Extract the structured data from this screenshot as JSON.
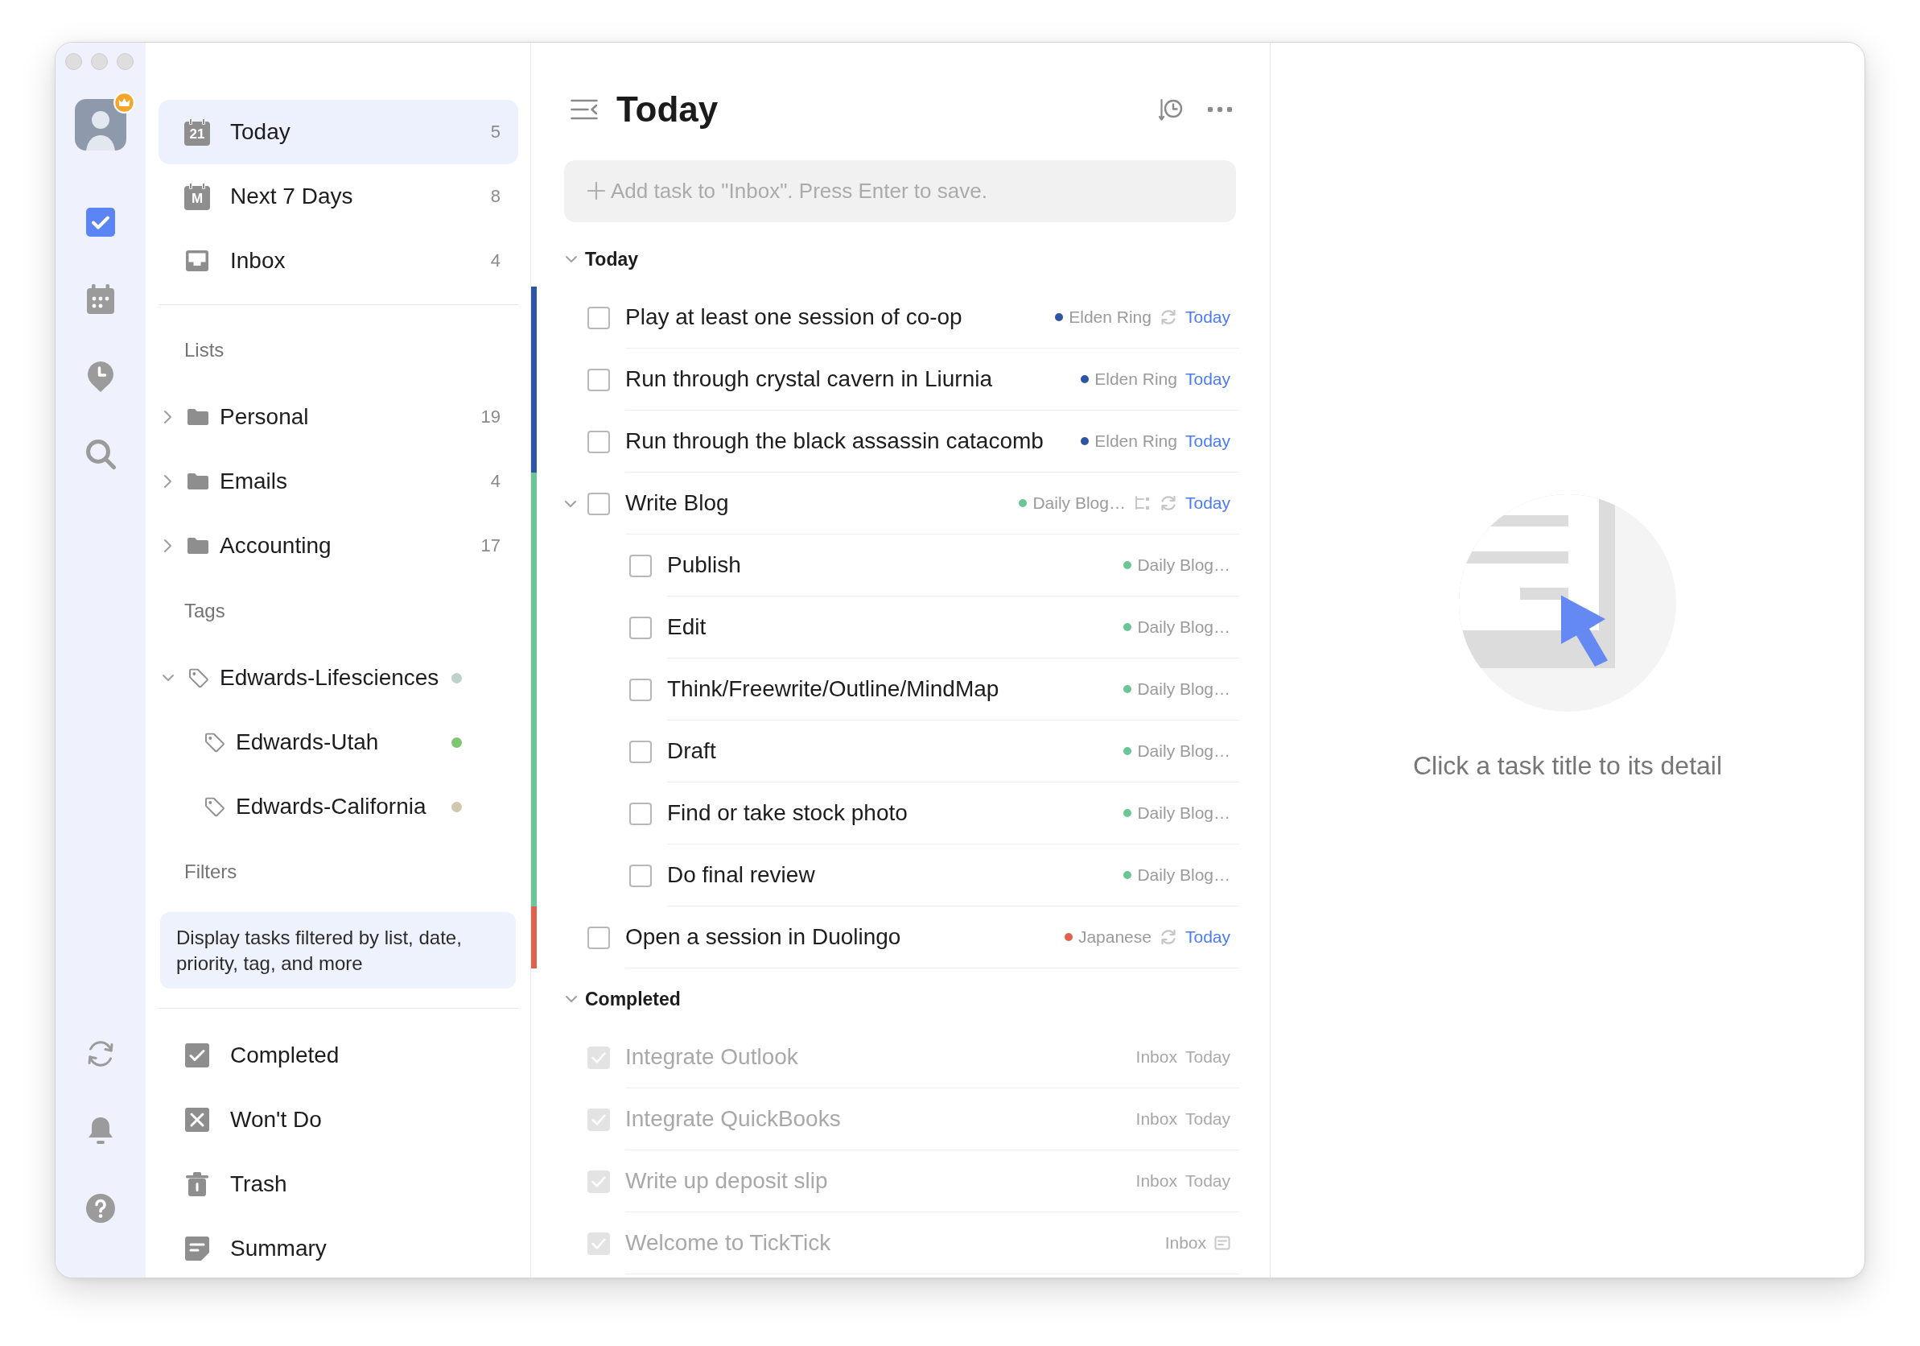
{
  "rail": {
    "avatar": {
      "premium": true
    },
    "top_items": [
      {
        "kind": "tasks",
        "selected": true
      },
      {
        "kind": "calendar",
        "selected": false
      },
      {
        "kind": "focus",
        "selected": false
      },
      {
        "kind": "search",
        "selected": false
      }
    ],
    "bottom_items": [
      {
        "kind": "sync"
      },
      {
        "kind": "notifications"
      },
      {
        "kind": "help"
      }
    ]
  },
  "sidebar": {
    "smart_lists": [
      {
        "kind": "today",
        "label": "Today",
        "icon_label": "21",
        "count": "5",
        "selected": true
      },
      {
        "kind": "week",
        "label": "Next 7 Days",
        "icon_label": "M",
        "count": "8",
        "selected": false
      },
      {
        "kind": "inbox",
        "label": "Inbox",
        "count": "4",
        "selected": false
      }
    ],
    "lists_title": "Lists",
    "lists": [
      {
        "label": "Personal",
        "count": "19",
        "expanded": false,
        "selected": false
      },
      {
        "label": "Emails",
        "count": "4",
        "expanded": false,
        "selected": false
      },
      {
        "label": "Accounting",
        "count": "17",
        "expanded": false,
        "selected": false
      }
    ],
    "tags_title": "Tags",
    "tags": [
      {
        "label": "Edwards-Lifesciences",
        "color": "#bed1cb",
        "expanded": true,
        "selected": false,
        "children": [
          {
            "label": "Edwards-Utah",
            "color": "#7dc76f",
            "selected": false
          },
          {
            "label": "Edwards-California",
            "color": "#cfc8ae",
            "selected": false
          }
        ]
      }
    ],
    "filters_title": "Filters",
    "filters_hint": "Display tasks filtered by list, date, priority, tag, and more",
    "system_lists": [
      {
        "kind": "completed",
        "label": "Completed",
        "selected": false
      },
      {
        "kind": "wont_do",
        "label": "Won't Do",
        "selected": false
      },
      {
        "kind": "trash",
        "label": "Trash",
        "selected": false
      },
      {
        "kind": "summary",
        "label": "Summary",
        "selected": false
      }
    ]
  },
  "main": {
    "title": "Today",
    "add_task": {
      "placeholder": "Add task to \"Inbox\". Press Enter to save."
    },
    "sections": [
      {
        "title": "Today",
        "expanded": true,
        "tasks": [
          {
            "title": "Play at least one session of co-op",
            "checked": false,
            "list": "Elden Ring",
            "color": "#2d55a6",
            "repeat": true,
            "due": "Today"
          },
          {
            "title": "Run through crystal cavern in Liurnia",
            "checked": false,
            "list": "Elden Ring",
            "color": "#2d55a6",
            "repeat": false,
            "due": "Today"
          },
          {
            "title": "Run through the black assassin catacomb",
            "checked": false,
            "list": "Elden Ring",
            "color": "#2d55a6",
            "repeat": false,
            "due": "Today"
          },
          {
            "title": "Write Blog",
            "checked": false,
            "list": "Daily Blog…",
            "color": "#6cc595",
            "repeat": true,
            "due": "Today",
            "expanded": true,
            "children": [
              {
                "title": "Publish",
                "checked": false,
                "list": "Daily Blog…",
                "color": "#6cc595"
              },
              {
                "title": "Edit",
                "checked": false,
                "list": "Daily Blog…",
                "color": "#6cc595"
              },
              {
                "title": "Think/Freewrite/Outline/MindMap",
                "checked": false,
                "list": "Daily Blog…",
                "color": "#6cc595"
              },
              {
                "title": "Draft",
                "checked": false,
                "list": "Daily Blog…",
                "color": "#6cc595"
              },
              {
                "title": "Find or take stock photo",
                "checked": false,
                "list": "Daily Blog…",
                "color": "#6cc595"
              },
              {
                "title": "Do final review",
                "checked": false,
                "list": "Daily Blog…",
                "color": "#6cc595"
              }
            ]
          },
          {
            "title": "Open a session in Duolingo",
            "checked": false,
            "list": "Japanese",
            "color": "#e0604e",
            "repeat": true,
            "due": "Today"
          }
        ]
      },
      {
        "title": "Completed",
        "expanded": true,
        "tasks": [
          {
            "title": "Integrate Outlook",
            "checked": true,
            "list": "Inbox",
            "due": "Today"
          },
          {
            "title": "Integrate QuickBooks",
            "checked": true,
            "list": "Inbox",
            "due": "Today"
          },
          {
            "title": "Write up deposit slip",
            "checked": true,
            "list": "Inbox",
            "due": "Today"
          },
          {
            "title": "Welcome to TickTick",
            "checked": true,
            "list": "Inbox",
            "note": true
          }
        ]
      }
    ]
  },
  "detail": {
    "empty_text": "Click a task title to its detail"
  }
}
